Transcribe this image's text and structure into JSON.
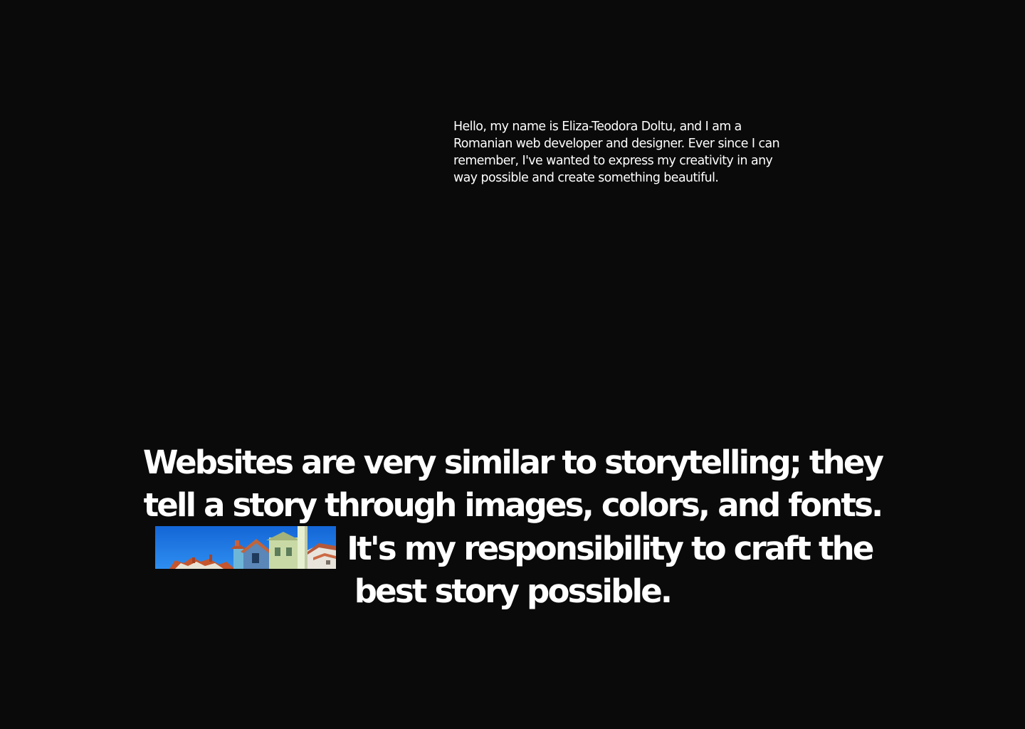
{
  "intro": {
    "text": "Hello, my name is Eliza-Teodora Doltu, and I am a Romanian web developer and designer. Ever since I can remember, I've wanted to express my creativity in any way possible and create something beautiful."
  },
  "statement": {
    "before_image": "Websites are very similar to storytelling; they tell a story through images, colors, and fonts.",
    "after_image": "It's my responsibility to craft the best story possible."
  },
  "image": {
    "icon": "rooftops-photo",
    "sky_color": "#1f7de0"
  },
  "colors": {
    "background": "#0a0a0a",
    "text": "#ffffff"
  }
}
